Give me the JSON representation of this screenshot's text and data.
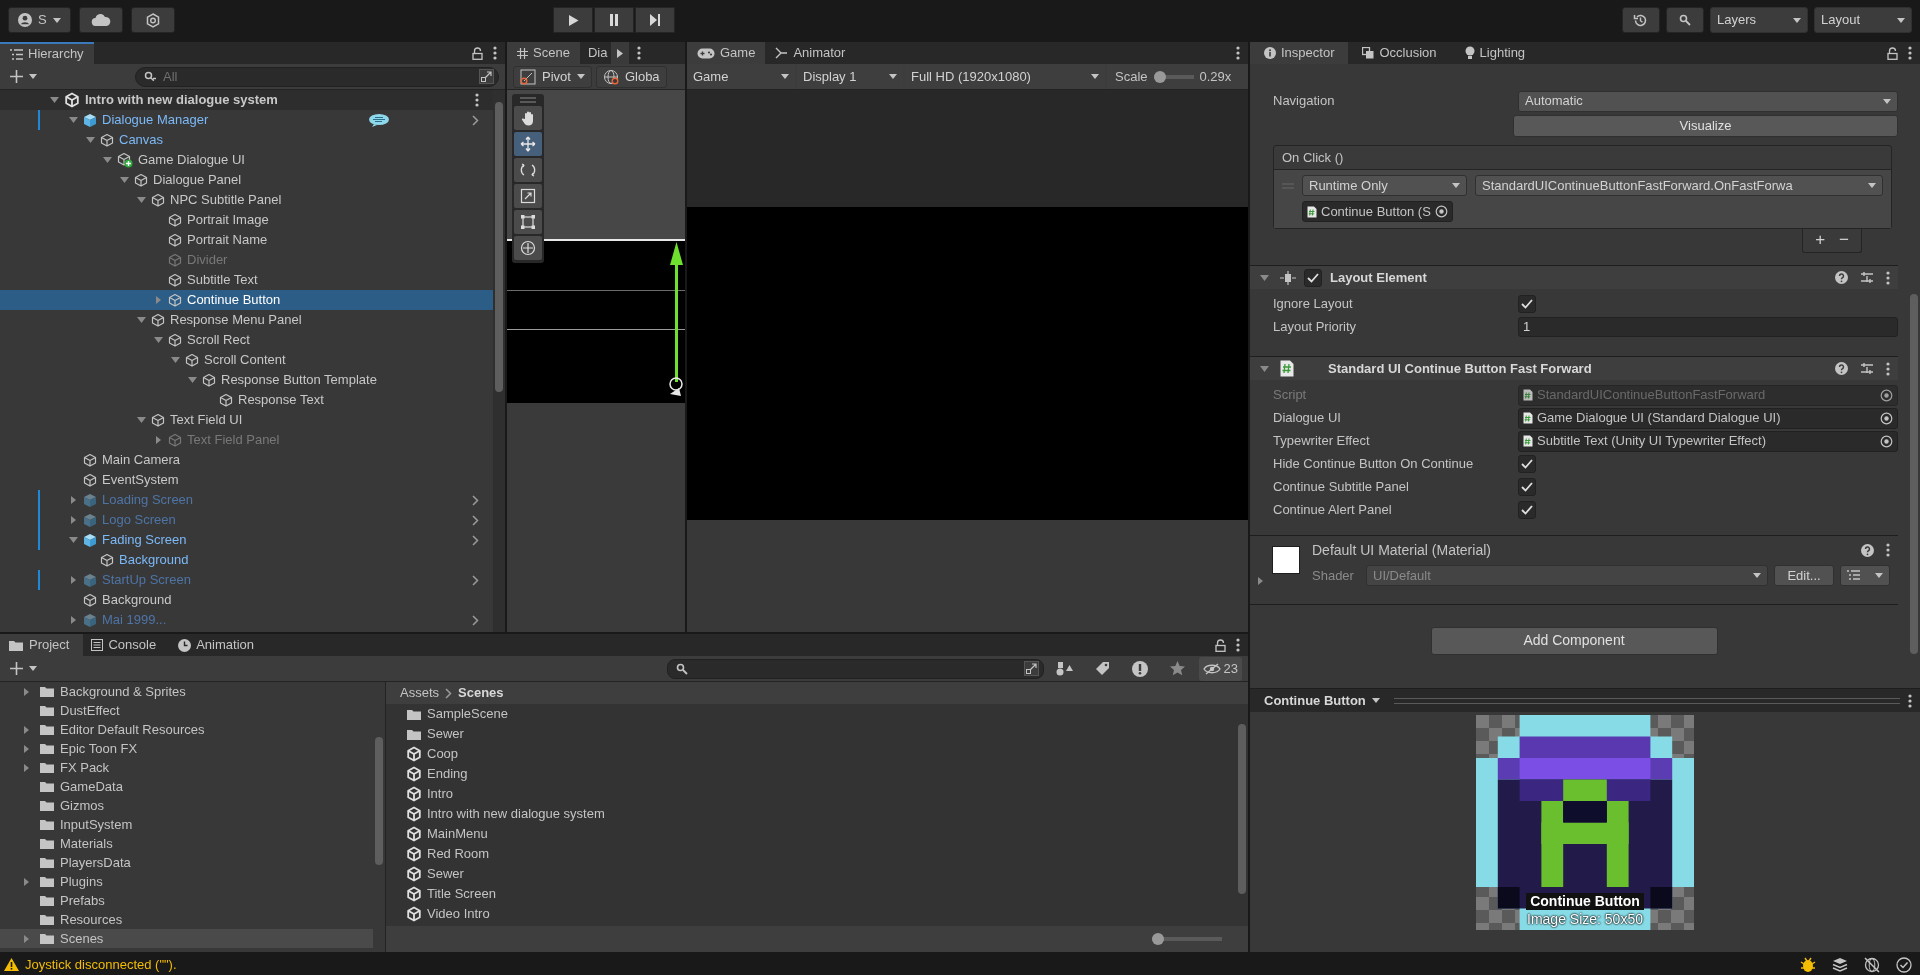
{
  "toolbar": {
    "account": "S",
    "layers": "Layers",
    "layout": "Layout"
  },
  "hierarchy": {
    "tab": "Hierarchy",
    "search": {
      "placeholder": "All"
    },
    "scene": {
      "name": "Intro with new dialogue system",
      "expanded": true
    },
    "items": [
      {
        "name": "Dialogue Manager",
        "kind": "prefab",
        "prefab_member": true,
        "inactive": false,
        "overridden": true,
        "annotated": true,
        "selected": false,
        "expanded": true,
        "children": [
          {
            "name": "Canvas",
            "kind": "object",
            "prefab_member": true,
            "inactive": false,
            "overridden": false,
            "annotated": false,
            "selected": false,
            "expanded": true,
            "children": [
              {
                "name": "Game Dialogue UI",
                "kind": "added",
                "prefab_member": false,
                "inactive": false,
                "overridden": false,
                "annotated": false,
                "selected": false,
                "expanded": true,
                "children": [
                  {
                    "name": "Dialogue Panel",
                    "kind": "object",
                    "prefab_member": false,
                    "inactive": false,
                    "overridden": false,
                    "annotated": false,
                    "selected": false,
                    "expanded": true,
                    "children": [
                      {
                        "name": "NPC Subtitle Panel",
                        "kind": "object",
                        "prefab_member": false,
                        "inactive": false,
                        "overridden": false,
                        "annotated": false,
                        "selected": false,
                        "expanded": true,
                        "children": [
                          {
                            "name": "Portrait Image",
                            "kind": "object",
                            "prefab_member": false,
                            "inactive": false,
                            "overridden": false,
                            "annotated": false,
                            "selected": false
                          },
                          {
                            "name": "Portrait Name",
                            "kind": "object",
                            "prefab_member": false,
                            "inactive": false,
                            "overridden": false,
                            "annotated": false,
                            "selected": false
                          },
                          {
                            "name": "Divider",
                            "kind": "object",
                            "prefab_member": false,
                            "inactive": true,
                            "overridden": false,
                            "annotated": false,
                            "selected": false
                          },
                          {
                            "name": "Subtitle Text",
                            "kind": "object",
                            "prefab_member": false,
                            "inactive": false,
                            "overridden": false,
                            "annotated": false,
                            "selected": false
                          },
                          {
                            "name": "Continue Button",
                            "kind": "object",
                            "prefab_member": false,
                            "inactive": false,
                            "overridden": false,
                            "annotated": false,
                            "selected": true,
                            "expanded": false
                          }
                        ]
                      },
                      {
                        "name": "Response Menu Panel",
                        "kind": "object",
                        "prefab_member": false,
                        "inactive": false,
                        "overridden": false,
                        "annotated": false,
                        "selected": false,
                        "expanded": true,
                        "children": [
                          {
                            "name": "Scroll Rect",
                            "kind": "object",
                            "prefab_member": false,
                            "inactive": false,
                            "overridden": false,
                            "annotated": false,
                            "selected": false,
                            "expanded": true,
                            "children": [
                              {
                                "name": "Scroll Content",
                                "kind": "object",
                                "prefab_member": false,
                                "inactive": false,
                                "overridden": false,
                                "annotated": false,
                                "selected": false,
                                "expanded": true,
                                "children": [
                                  {
                                    "name": "Response Button Template",
                                    "kind": "object",
                                    "prefab_member": false,
                                    "inactive": false,
                                    "overridden": false,
                                    "annotated": false,
                                    "selected": false,
                                    "expanded": true,
                                    "children": [
                                      {
                                        "name": "Response Text",
                                        "kind": "object",
                                        "prefab_member": false,
                                        "inactive": false,
                                        "overridden": false,
                                        "annotated": false,
                                        "selected": false
                                      }
                                    ]
                                  }
                                ]
                              }
                            ]
                          }
                        ]
                      },
                      {
                        "name": "Text Field UI",
                        "kind": "object",
                        "prefab_member": false,
                        "inactive": false,
                        "overridden": false,
                        "annotated": false,
                        "selected": false,
                        "expanded": true,
                        "children": [
                          {
                            "name": "Text Field Panel",
                            "kind": "object",
                            "prefab_member": false,
                            "inactive": true,
                            "overridden": false,
                            "annotated": false,
                            "selected": false,
                            "expanded": false
                          }
                        ]
                      }
                    ]
                  }
                ]
              }
            ]
          }
        ]
      },
      {
        "name": "Main Camera",
        "kind": "object",
        "prefab_member": false,
        "inactive": false,
        "overridden": false,
        "annotated": false,
        "selected": false
      },
      {
        "name": "EventSystem",
        "kind": "object",
        "prefab_member": false,
        "inactive": false,
        "overridden": false,
        "annotated": false,
        "selected": false
      },
      {
        "name": "Loading Screen",
        "kind": "prefab",
        "prefab_member": true,
        "inactive": true,
        "overridden": true,
        "annotated": false,
        "selected": false,
        "expanded": false
      },
      {
        "name": "Logo Screen",
        "kind": "prefab",
        "prefab_member": true,
        "inactive": true,
        "overridden": true,
        "annotated": false,
        "selected": false,
        "expanded": false
      },
      {
        "name": "Fading Screen",
        "kind": "prefab",
        "prefab_member": true,
        "inactive": false,
        "overridden": true,
        "annotated": false,
        "selected": false,
        "expanded": true,
        "children": [
          {
            "name": "Background",
            "kind": "object",
            "prefab_member": true,
            "inactive": false,
            "overridden": false,
            "annotated": false,
            "selected": false
          }
        ]
      },
      {
        "name": "StartUp Screen",
        "kind": "prefab",
        "prefab_member": true,
        "inactive": true,
        "overridden": true,
        "annotated": false,
        "selected": false,
        "expanded": false
      },
      {
        "name": "Background",
        "kind": "object",
        "prefab_member": false,
        "inactive": false,
        "overridden": false,
        "annotated": false,
        "selected": false
      },
      {
        "name": "Mai 1999...",
        "kind": "prefab",
        "prefab_member": true,
        "inactive": true,
        "overridden": false,
        "annotated": false,
        "selected": false,
        "expanded": false
      }
    ]
  },
  "scene_view": {
    "tabs": [
      {
        "kind": "scene",
        "label": "Scene",
        "selected": true
      },
      {
        "kind": "plain",
        "label": "Dia",
        "selected": false
      }
    ],
    "pivot": "Pivot",
    "handle_space": "Globa",
    "tools": [
      {
        "kind": "hand",
        "selected": false
      },
      {
        "kind": "move",
        "selected": true
      },
      {
        "kind": "rotate",
        "selected": false
      },
      {
        "kind": "scale",
        "selected": false
      },
      {
        "kind": "rect",
        "selected": false
      },
      {
        "kind": "transform",
        "selected": false
      }
    ]
  },
  "game_view": {
    "tabs": [
      {
        "kind": "game",
        "label": "Game",
        "selected": true
      },
      {
        "kind": "animator",
        "label": "Animator",
        "selected": false
      }
    ],
    "view_mode": "Game",
    "display": "Display 1",
    "resolution": "Full HD (1920x1080)",
    "scale_label": "Scale",
    "scale": {
      "level": 0
    },
    "scale_reading": "0.29x"
  },
  "inspector": {
    "tabs": [
      {
        "kind": "info",
        "label": "Inspector",
        "selected": true
      },
      {
        "kind": "occlusion",
        "label": "Occlusion",
        "selected": false
      },
      {
        "kind": "lighting",
        "label": "Lighting",
        "selected": false
      }
    ],
    "navigation": {
      "label": "Navigation",
      "value": "Automatic"
    },
    "visualize": "Visualize",
    "on_click": {
      "title": "On Click ()",
      "mode": "Runtime Only",
      "function": "StandardUIContinueButtonFastForward.OnFastForwa",
      "target": "Continue Button (S",
      "add": "+",
      "remove": "−"
    },
    "components": [
      {
        "kind": "layout",
        "title": "Layout Element",
        "enabled": true,
        "expanded": true,
        "fields": [
          {
            "kind": "checkbox",
            "label": "Ignore Layout",
            "checked": true
          },
          {
            "kind": "number",
            "label": "Layout Priority",
            "value": "1"
          }
        ]
      },
      {
        "kind": "script",
        "title": "Standard UI Continue Button Fast Forward",
        "expanded": true,
        "fields": [
          {
            "kind": "object",
            "label": "Script",
            "value": "StandardUIContinueButtonFastForward",
            "disabled": true
          },
          {
            "kind": "object",
            "label": "Dialogue UI",
            "value": "Game Dialogue UI (Standard Dialogue UI)",
            "disabled": false
          },
          {
            "kind": "object",
            "label": "Typewriter Effect",
            "value": "Subtitle Text (Unity UI Typewriter Effect)",
            "disabled": false
          },
          {
            "kind": "checkbox",
            "label": "Hide Continue Button On Continue",
            "checked": true
          },
          {
            "kind": "checkbox",
            "label": "Continue Subtitle Panel",
            "checked": true
          },
          {
            "kind": "checkbox",
            "label": "Continue Alert Panel",
            "checked": true
          }
        ]
      }
    ],
    "material": {
      "name": "Default UI Material (Material)",
      "expanded": false,
      "shader_label": "Shader",
      "shader": "UI/Default",
      "edit": "Edit..."
    },
    "add_component": "Add Component",
    "preview": {
      "title": "Continue Button",
      "caption": "Continue Button",
      "size": "Image Size: 50x50"
    }
  },
  "project": {
    "tabs": [
      {
        "kind": "project",
        "label": "Project",
        "selected": true
      },
      {
        "kind": "console",
        "label": "Console",
        "selected": false
      },
      {
        "kind": "animation",
        "label": "Animation",
        "selected": false
      }
    ],
    "hidden_count": "23",
    "folders": [
      {
        "name": "Background & Sprites",
        "expanded": false,
        "selected": false
      },
      {
        "name": "DustEffect",
        "selected": false
      },
      {
        "name": "Editor Default Resources",
        "expanded": false,
        "selected": false
      },
      {
        "name": "Epic Toon FX",
        "expanded": false,
        "selected": false
      },
      {
        "name": "FX Pack",
        "expanded": false,
        "selected": false
      },
      {
        "name": "GameData",
        "selected": false
      },
      {
        "name": "Gizmos",
        "selected": false
      },
      {
        "name": "InputSystem",
        "selected": false
      },
      {
        "name": "Materials",
        "selected": false
      },
      {
        "name": "PlayersData",
        "selected": false
      },
      {
        "name": "Plugins",
        "expanded": false,
        "selected": false
      },
      {
        "name": "Prefabs",
        "selected": false
      },
      {
        "name": "Resources",
        "selected": false
      },
      {
        "name": "Scenes",
        "expanded": false,
        "selected": true
      }
    ],
    "breadcrumb": [
      "Assets",
      "Scenes"
    ],
    "assets": [
      {
        "kind": "folder",
        "name": "SampleScene"
      },
      {
        "kind": "folder",
        "name": "Sewer"
      },
      {
        "kind": "scene",
        "name": "Coop"
      },
      {
        "kind": "scene",
        "name": "Ending"
      },
      {
        "kind": "scene",
        "name": "Intro"
      },
      {
        "kind": "scene",
        "name": "Intro with new dialogue system"
      },
      {
        "kind": "scene",
        "name": "MainMenu"
      },
      {
        "kind": "scene",
        "name": "Red Room"
      },
      {
        "kind": "scene",
        "name": "Sewer"
      },
      {
        "kind": "scene",
        "name": "Title Screen"
      },
      {
        "kind": "scene",
        "name": "Video Intro"
      }
    ],
    "zoom": {
      "level": 0
    }
  },
  "status_bar": {
    "kind": "warning",
    "message": "Joystick disconnected (\"\")."
  }
}
